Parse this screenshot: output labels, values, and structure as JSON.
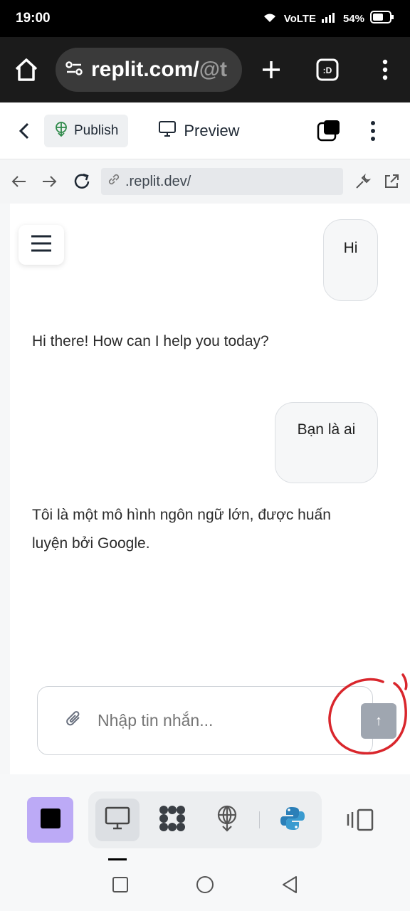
{
  "status_bar": {
    "time": "19:00",
    "network": "VoLTE",
    "battery": "54%"
  },
  "browser": {
    "url_visible": "replit.com/",
    "url_faded": "@t"
  },
  "header": {
    "publish_label": "Publish",
    "preview_label": "Preview"
  },
  "address_bar": {
    "url": ".replit.dev/"
  },
  "chat": {
    "messages": [
      {
        "role": "user",
        "text": "Hi"
      },
      {
        "role": "assistant",
        "text": "Hi there! How can I help you today?"
      },
      {
        "role": "user",
        "text": "Bạn là ai"
      },
      {
        "role": "assistant",
        "text": "Tôi là một mô hình ngôn ngữ lớn, được huấn luyện bởi Google."
      }
    ],
    "composer_placeholder": "Nhập tin nhắn...",
    "send_label": "↑"
  },
  "colors": {
    "annotation_circle": "#d9262c",
    "accent_purple": "#bcaaf6",
    "send_button": "#9fa6b0"
  }
}
